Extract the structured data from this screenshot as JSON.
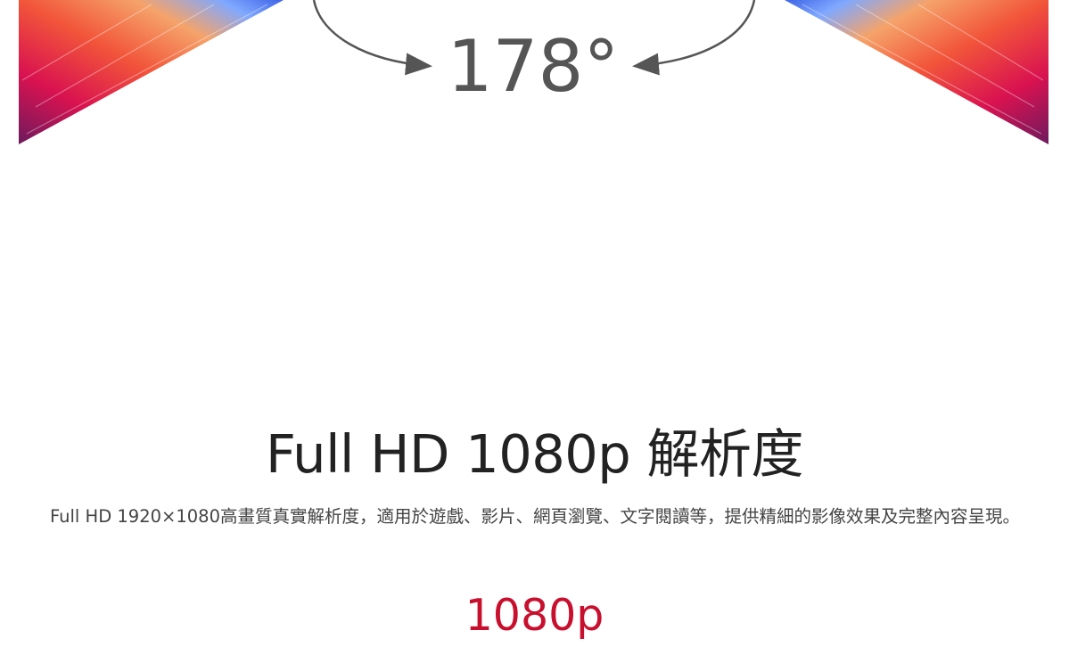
{
  "banner": {
    "viewing_angle_label": "178°",
    "accent_colors": [
      "#e3124d",
      "#f36b3b",
      "#4b7cff",
      "#7b2a8c"
    ]
  },
  "feature": {
    "heading": "Full HD 1080p 解析度",
    "description": "Full HD 1920×1080高畫質真實解析度，適用於遊戲、影片、網頁瀏覽、文字閱讀等，提供精細的影像效果及完整內容呈現。",
    "resolution_label": "1080p"
  }
}
